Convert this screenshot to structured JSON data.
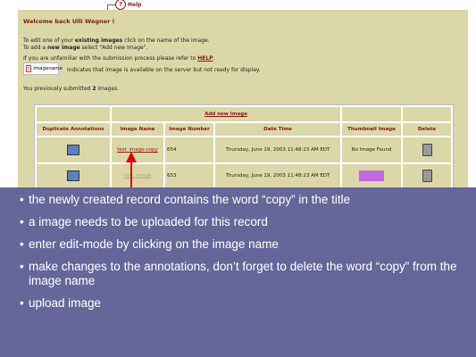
{
  "help": {
    "label": "Help"
  },
  "panel": {
    "welcome": "Welcome back Ulli Wegner !",
    "line1_a": "To edit one of your ",
    "line1_b": "existing images",
    "line1_c": " click on the name of the image.",
    "line2_a": "To add a ",
    "line2_b": "new image",
    "line2_c": " select \"Add new Image\".",
    "line3_a": "If you are unfamiliar with the submission process please refer to ",
    "line3_link": "HELP",
    "line3_c": ".",
    "imgname_label": "imagename",
    "imgname_desc": "indicates that image is available on the server but not ready for display.",
    "submitted_a": "You previously submitted ",
    "submitted_b": "2",
    "submitted_c": " images."
  },
  "table": {
    "add_new": "Add new Image",
    "headers": [
      "Duplicate Annotations",
      "Image Name",
      "Image Number",
      "Date Time",
      "Thumbnail Image",
      "Delete"
    ],
    "rows": [
      {
        "name": "test_image-copy",
        "number": "654",
        "datetime": "Thursday, June 19, 2003 11:48:23 AM EDT",
        "thumb": "No Image Found"
      },
      {
        "name": "test_image",
        "number": "653",
        "datetime": "Thursday, June 19, 2003 11:48:23 AM EDT",
        "thumb": ""
      }
    ]
  },
  "bullets": [
    "the newly created record contains the word “copy” in the title",
    "a image needs to be uploaded for this record",
    "enter edit-mode by clicking on the image name",
    "make changes to the annotations, don’t forget to delete the  word “copy” from the image name",
    "upload image"
  ],
  "colors": {
    "panel": "#dcd7a8",
    "accent": "#8a1a1a",
    "overlay": "#66669a",
    "arrow": "#e00000"
  }
}
